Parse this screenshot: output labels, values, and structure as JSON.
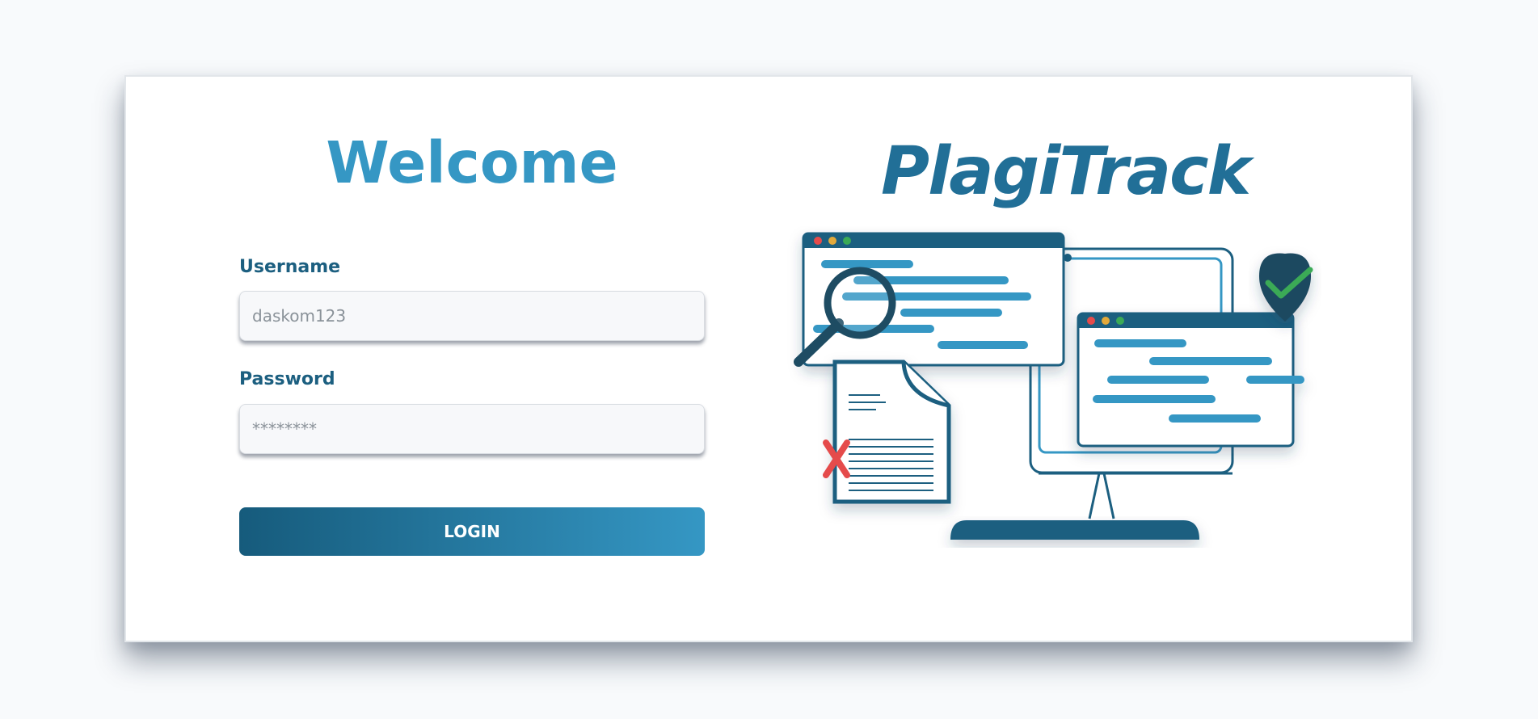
{
  "login": {
    "heading": "Welcome",
    "username_label": "Username",
    "username_placeholder": "daskom123",
    "password_label": "Password",
    "password_placeholder": "********",
    "login_button": "LOGIN"
  },
  "brand": {
    "name": "PlagiTrack"
  },
  "illustration": {
    "icons": [
      "browser-window-icon",
      "magnifier-icon",
      "document-icon",
      "reject-x-icon",
      "monitor-icon",
      "check-shield-icon"
    ]
  },
  "colors": {
    "primary": "#3597c4",
    "primary_dark": "#165b7c",
    "navy": "#1c5f80",
    "success": "#3aaa57",
    "danger": "#e54b4b"
  }
}
